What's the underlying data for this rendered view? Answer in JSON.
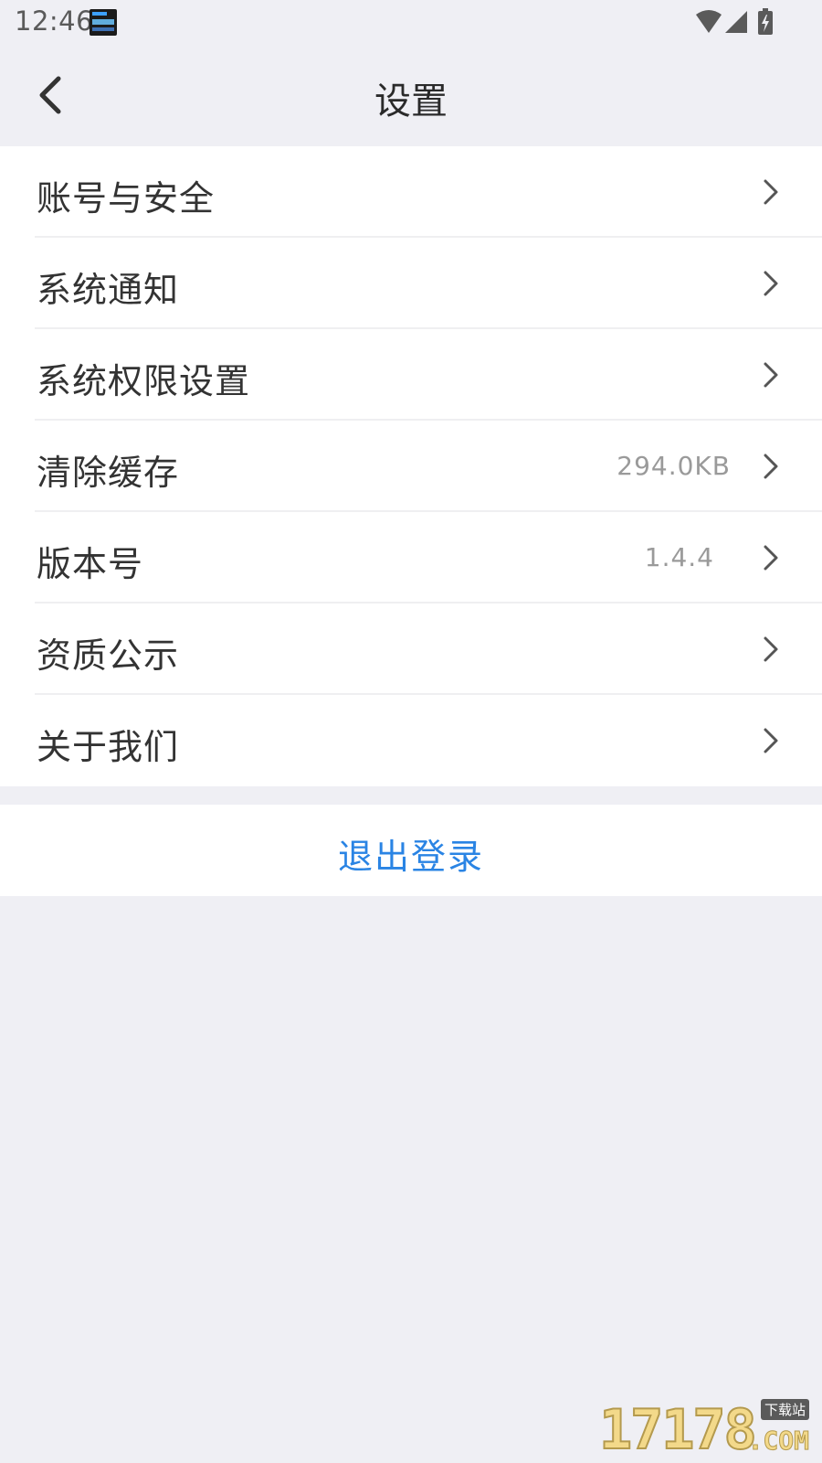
{
  "status_bar": {
    "time": "12:46",
    "notification_icon": "app-notification-icon",
    "icons": [
      "wifi-icon",
      "cell-signal-icon",
      "battery-charging-icon"
    ]
  },
  "header": {
    "title": "设置",
    "back_icon": "chevron-left-icon"
  },
  "menu": {
    "items": [
      {
        "label": "账号与安全",
        "value": ""
      },
      {
        "label": "系统通知",
        "value": ""
      },
      {
        "label": "系统权限设置",
        "value": ""
      },
      {
        "label": "清除缓存",
        "value": "294.0KB"
      },
      {
        "label": "版本号",
        "value": "1.4.4"
      },
      {
        "label": "资质公示",
        "value": ""
      },
      {
        "label": "关于我们",
        "value": ""
      }
    ]
  },
  "logout": {
    "label": "退出登录"
  },
  "watermark": {
    "digits": "17178",
    "suffix": ".COM",
    "tag": "下载站"
  },
  "colors": {
    "background": "#efeff4",
    "surface": "#ffffff",
    "text": "#333333",
    "secondary_text": "#9a9a9a",
    "accent": "#2a84e4"
  }
}
